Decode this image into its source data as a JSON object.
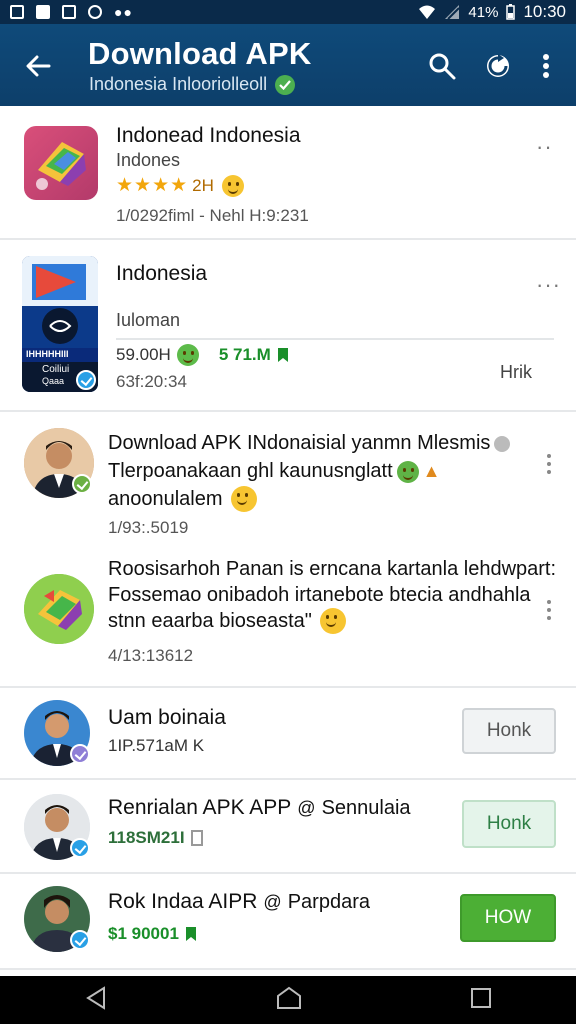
{
  "status_bar": {
    "time": "10:30",
    "battery": "41%",
    "icons": [
      "gallery-icon",
      "image-icon",
      "chat-icon",
      "shield-icon"
    ]
  },
  "app_bar": {
    "title": "Download APK",
    "subtitle": "Indonesia Inlooriolleoll",
    "icons": [
      "back-arrow-icon",
      "search-icon",
      "refresh-icon",
      "more-vert-icon"
    ]
  },
  "apps": [
    {
      "name": "Indonead Indonesia",
      "developer": "Indones",
      "rating_text": "2H",
      "date_line": "1/0292fiml  -  Nehl H:9:231",
      "icon": "folded-colors-icon"
    },
    {
      "name": "Indonesia",
      "developer": "Iuloman",
      "size_line": "59.00H",
      "downloads": "5 71.M",
      "date_line": "63f:20:34",
      "action": "Hrik",
      "icon_label_top": "IHHHHHIII",
      "icon_label_bottom": "Coiliui",
      "icon_label_bottom2": "Qaaa"
    }
  ],
  "posts": [
    {
      "line1": "Download APK INdonaisial yanmn Mlesmis",
      "line2": "Tlerpoanakaan ghl kaunusnglatt",
      "line3": "anoonulalem",
      "date": "1/93:.5019"
    },
    {
      "line1": "Roosisarhoh Panan is erncana kartanla lehdwpart:",
      "line2": "Fossemao onibadoh irtanebote btecia andhahla",
      "line3": "stnn eaarba bioseasta\"",
      "date": "4/13:13612"
    }
  ],
  "users": [
    {
      "name": "Uam boinaia",
      "meta": "1IP.571aM K",
      "action": "Honk",
      "style": "grey"
    },
    {
      "name": "Renrialan APK APP",
      "handle": "Sennulaia",
      "meta": "118SM21I",
      "action": "Honk",
      "style": "lightgreen"
    },
    {
      "name": "Rok Indaa AIPR",
      "handle": "Parpdara",
      "meta": "$1 90001",
      "action": "HOW",
      "style": "green"
    }
  ],
  "nav_bar": {
    "icons": [
      "back-triangle-icon",
      "home-icon",
      "recents-square-icon"
    ]
  },
  "colors": {
    "app_bar": "#0d3f6a",
    "accent_green": "#4caf35",
    "star": "#f2a60c"
  }
}
